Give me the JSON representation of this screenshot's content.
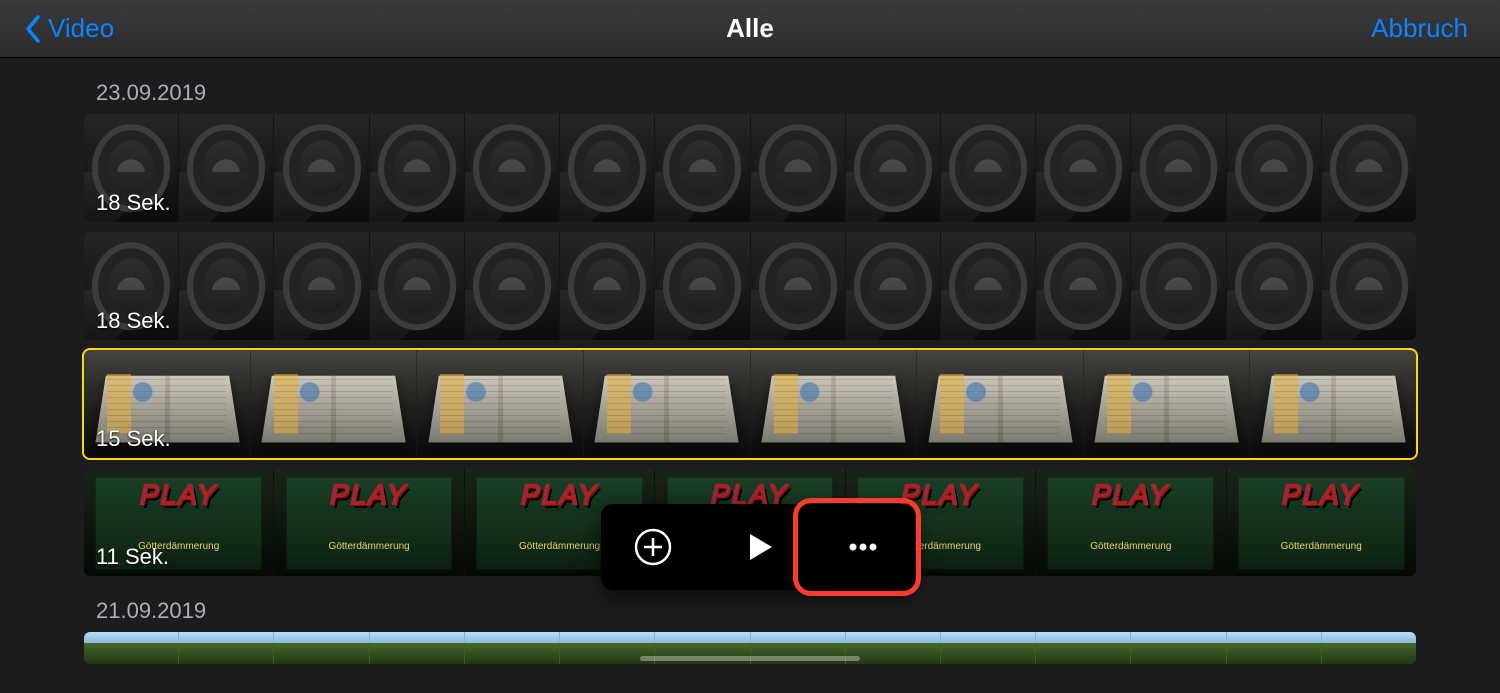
{
  "header": {
    "back_label": "Video",
    "title": "Alle",
    "cancel_label": "Abbruch"
  },
  "groups": [
    {
      "date": "23.09.2019",
      "clips": [
        {
          "duration": "18 Sek.",
          "style": "reel",
          "frames": 14,
          "selected": false
        },
        {
          "duration": "18 Sek.",
          "style": "reel",
          "frames": 14,
          "selected": false
        },
        {
          "duration": "15 Sek.",
          "style": "book",
          "frames": 8,
          "selected": true
        },
        {
          "duration": "11 Sek.",
          "style": "cover",
          "frames": 7,
          "selected": false
        }
      ]
    },
    {
      "date": "21.09.2019",
      "clips": [
        {
          "duration": "",
          "style": "grass",
          "frames": 14,
          "selected": false
        }
      ]
    }
  ],
  "popover": {
    "add_label": "Hinzufügen",
    "play_label": "Abspielen",
    "more_label": "Mehr"
  },
  "highlighted_button": "more"
}
